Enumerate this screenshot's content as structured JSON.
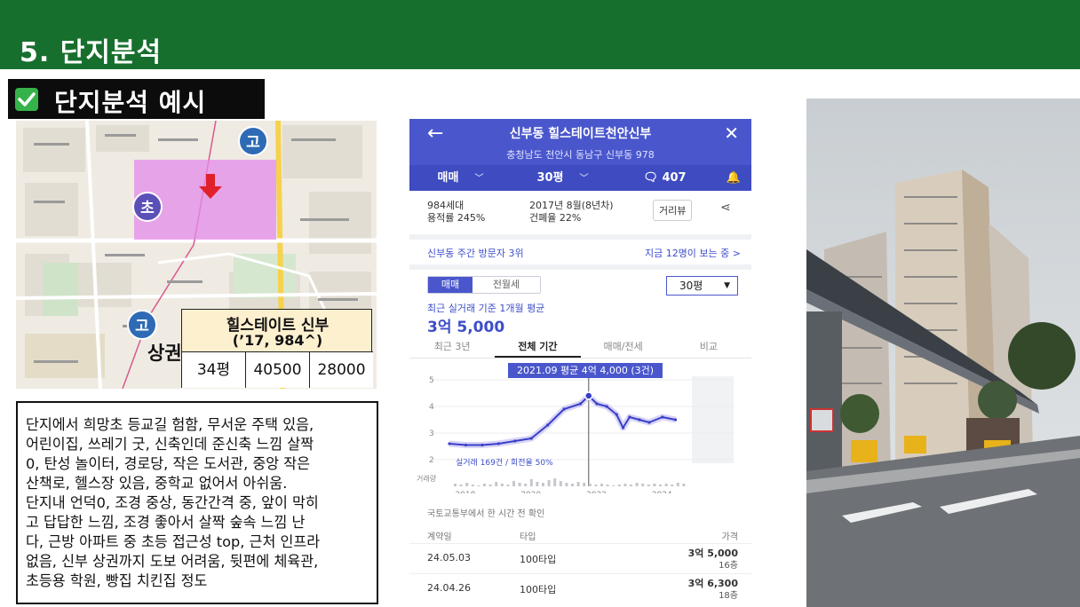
{
  "header": {
    "title": "5. 단지분석"
  },
  "section": {
    "label": "단지분석 예시"
  },
  "map": {
    "badges": [
      "고",
      "초",
      "고"
    ],
    "area_label": "상권"
  },
  "apt_box": {
    "name": "힐스테이트 신부",
    "sub": "(’17, 984^)",
    "cells": [
      "34평",
      "40500",
      "28000"
    ]
  },
  "notes": {
    "lines": [
      "단지에서 희망초 등교길 험함, 무서운 주택 있음,",
      "어린이집, 쓰레기 굿, 신축인데 준신축 느낌 살짝",
      "0, 탄성 놀이터, 경로당, 작은 도서관, 중앙 작은",
      "산책로, 헬스장 있음, 중학교 없어서 아쉬움.",
      "단지내 언덕0, 조경 중상, 동간간격 중, 앞이 막히",
      "고 답답한 느낌, 조경 좋아서 살짝 숲속 느낌 난",
      "다, 근방 아파트 중 초등 접근성 top, 근처 인프라",
      "없음, 신부 상권까지 도보 어려움, 뒷편에 체육관,",
      "초등용 학원, 빵집 치킨집 정도"
    ]
  },
  "phone": {
    "title": "신부동 힐스테이트천안신부",
    "address": "충청남도 천안시 동남구 신부동 978",
    "tabs": [
      "매매",
      "30평",
      "407"
    ],
    "info_a": [
      "984세대",
      "용적률 245%"
    ],
    "info_b": [
      "2017년 8월(8년차)",
      "건폐율 22%"
    ],
    "road_view": "거리뷰",
    "visit_left": "신부동 주간 방문자 3위",
    "visit_right": "지금 12명이 보는 중 >",
    "toggle_on": "매매",
    "toggle_off": "전월세",
    "size": "30평",
    "avg_label": "최근 실거래 기준 1개월 평균",
    "avg_value": "3억 5,000",
    "range_tabs": [
      "최근 3년",
      "전체 기간",
      "매매/전세",
      "비교"
    ],
    "tooltip": "2021.09 평균 4억 4,000 (3건)",
    "chart_caption": "실거래 169건 / 회전율 50%",
    "volume_label": "거래량",
    "source": "국토교통부에서 한 시간 전 확인",
    "table_headers": [
      "계약일",
      "타입",
      "가격"
    ],
    "rows": [
      {
        "date": "24.05.03",
        "type": "100타입",
        "price": "3억 5,000",
        "floor": "16층"
      },
      {
        "date": "24.04.26",
        "type": "100타입",
        "price": "3억 6,300",
        "floor": "18층"
      }
    ]
  },
  "chart_data": {
    "type": "line",
    "title": "",
    "xlabel": "",
    "ylabel": "",
    "x": [
      2017.5,
      2018.0,
      2018.5,
      2019.0,
      2019.5,
      2020.0,
      2020.5,
      2021.0,
      2021.5,
      2021.75,
      2022.0,
      2022.3,
      2022.6,
      2022.8,
      2023.0,
      2023.3,
      2023.6,
      2024.0,
      2024.4
    ],
    "values": [
      2.6,
      2.55,
      2.55,
      2.6,
      2.7,
      2.8,
      3.3,
      3.9,
      4.1,
      4.4,
      4.1,
      4.0,
      3.7,
      3.2,
      3.6,
      3.5,
      3.4,
      3.6,
      3.5
    ],
    "x_ticks": [
      "2018",
      "2020",
      "2022",
      "2024"
    ],
    "y_ticks": [
      "2억",
      "3억",
      "4억",
      "5억"
    ],
    "ylim": [
      2,
      5
    ]
  }
}
